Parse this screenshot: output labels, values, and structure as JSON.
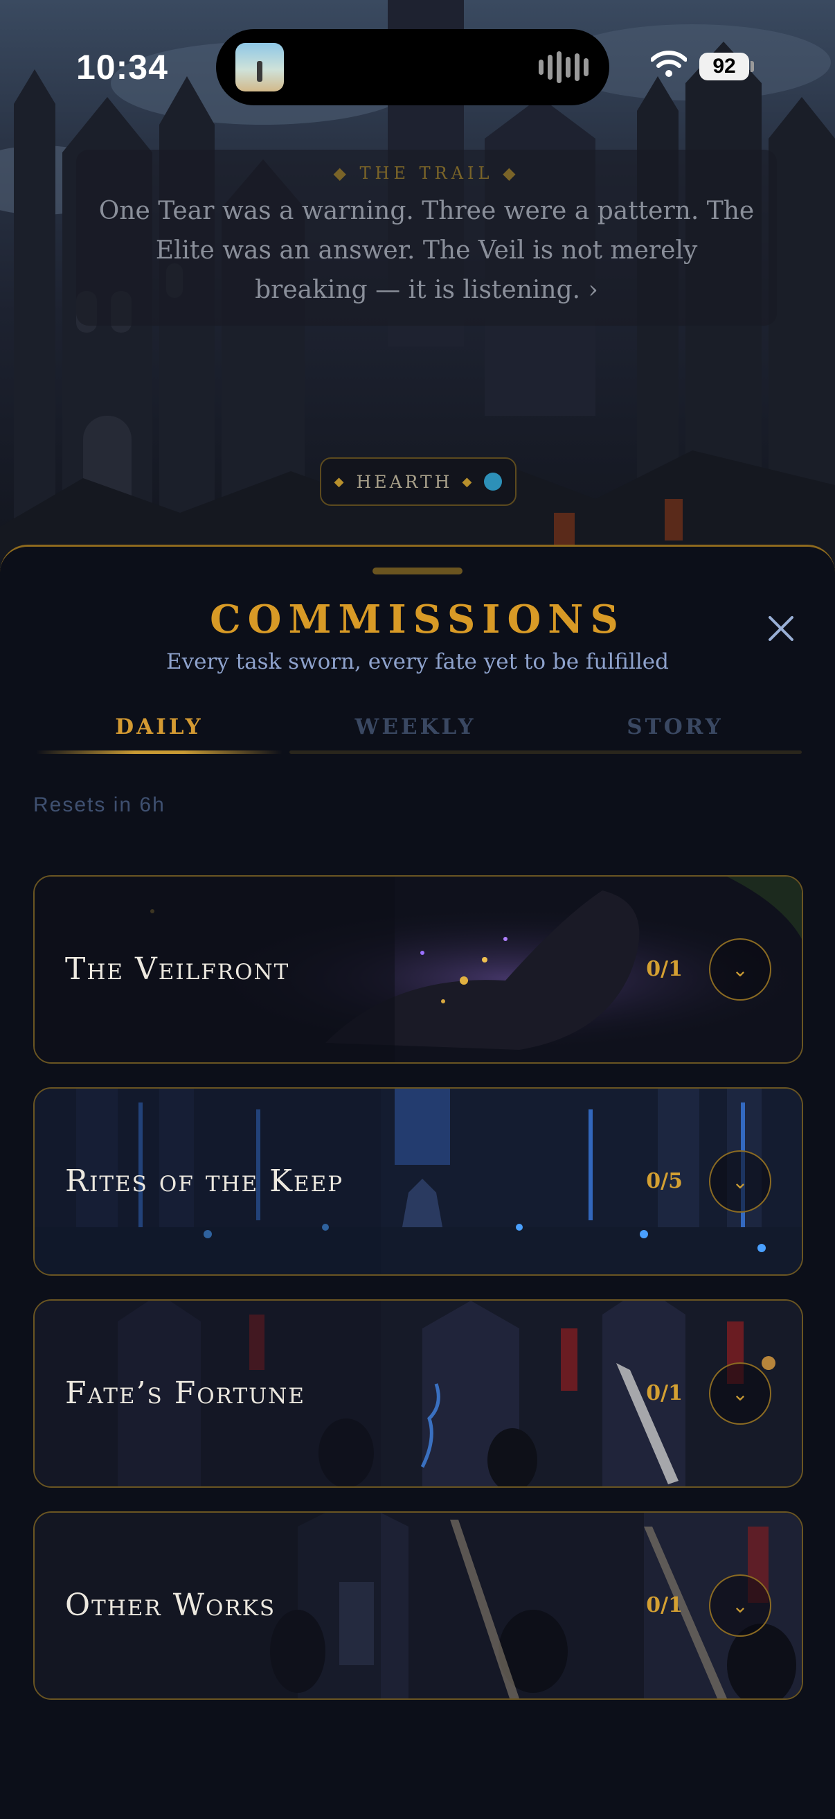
{
  "status_bar": {
    "time": "10:34",
    "battery": "92"
  },
  "trail": {
    "label": "THE TRAIL",
    "text": "One Tear was a warning. Three were a pattern. The Elite was an answer. The Veil is not merely breaking — it is listening. ›"
  },
  "hearth": {
    "label": "HEARTH"
  },
  "sheet": {
    "title": "COMMISSIONS",
    "subtitle": "Every task sworn, every fate yet to be fulfilled",
    "close_icon": "close-icon",
    "tabs": [
      {
        "label": "DAILY",
        "active": true
      },
      {
        "label": "WEEKLY",
        "active": false
      },
      {
        "label": "STORY",
        "active": false
      }
    ],
    "resets": "Resets in 6h",
    "cards": [
      {
        "title": "The Veilfront",
        "progress": "0/1"
      },
      {
        "title": "Rites of the Keep",
        "progress": "0/5"
      },
      {
        "title": "Fate’s Fortune",
        "progress": "0/1"
      },
      {
        "title": "Other Works",
        "progress": "0/1"
      }
    ]
  },
  "colors": {
    "accent_gold": "#d89a26",
    "sheet_bg": "#0c0f19",
    "muted_blue": "#8ea2cc"
  }
}
